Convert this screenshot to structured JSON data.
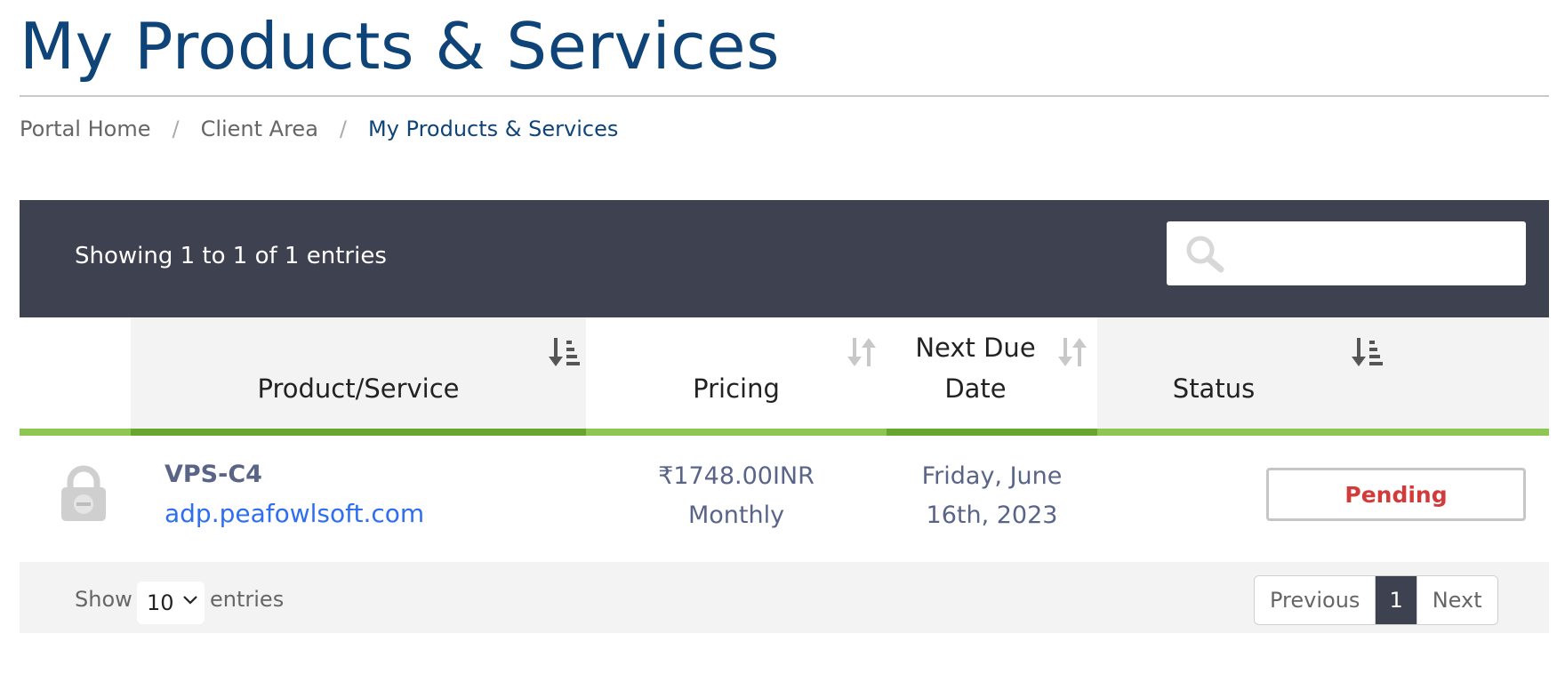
{
  "page": {
    "title": "My Products & Services"
  },
  "breadcrumb": [
    {
      "label": "Portal Home"
    },
    {
      "label": "Client Area"
    },
    {
      "label": "My Products & Services"
    }
  ],
  "table_header": {
    "showing": "Showing 1 to 1 of 1 entries",
    "search": {
      "placeholder": "",
      "value": ""
    }
  },
  "columns": [
    {
      "label": ""
    },
    {
      "label": "Product/Service",
      "sort": "sorted-desc"
    },
    {
      "label": "Pricing",
      "sort": "unsorted"
    },
    {
      "label": "Next Due Date",
      "sort": "unsorted"
    },
    {
      "label": "Status",
      "sort": "sorted-desc"
    }
  ],
  "rows": [
    {
      "icon": "lock-icon",
      "product_name": "VPS-C4",
      "domain": "adp.peafowlsoft.com",
      "price": "₹1748.00INR",
      "cycle": "Monthly",
      "due_line1": "Friday, June",
      "due_line2": "16th, 2023",
      "status": "Pending"
    }
  ],
  "footer": {
    "show_label": "Show",
    "page_length": "10",
    "entries_label": "entries",
    "pagination": {
      "previous": "Previous",
      "current": "1",
      "next": "Next"
    }
  },
  "colors": {
    "title": "#0f4478",
    "header_bar": "#3d4150",
    "accent_green": "#8dc652",
    "sorted_green": "#67a52d",
    "status_pending": "#d33b3b",
    "link": "#2e6ef0"
  }
}
